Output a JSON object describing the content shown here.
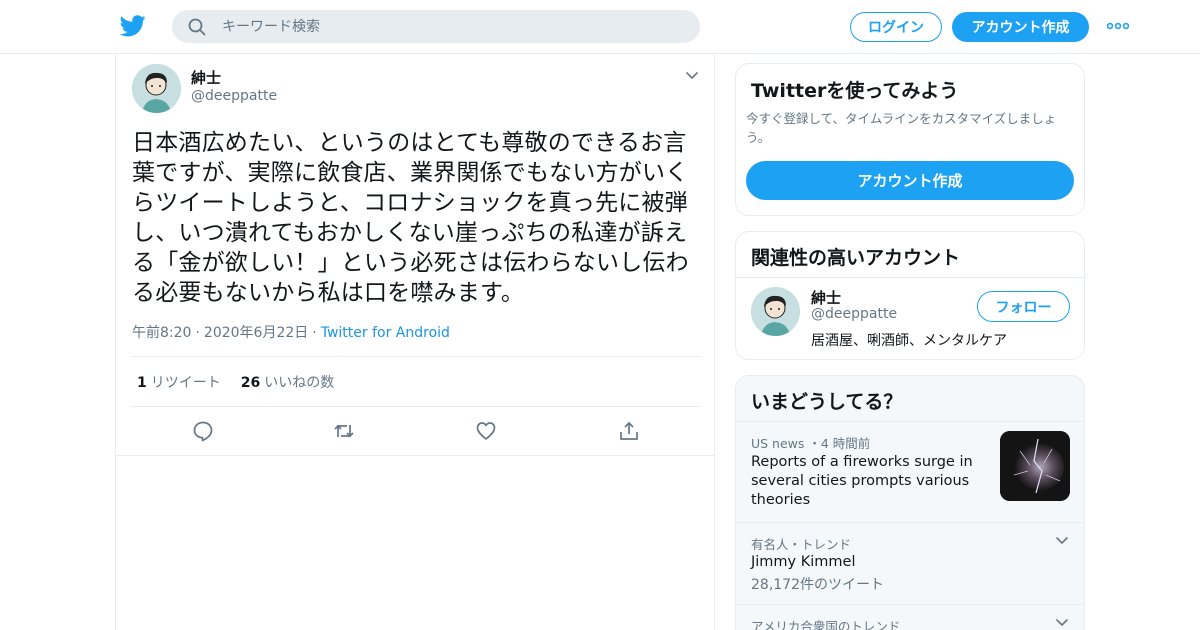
{
  "header": {
    "search_placeholder": "キーワード検索",
    "login_label": "ログイン",
    "signup_label": "アカウント作成"
  },
  "tweet": {
    "author_name": "紳士",
    "author_handle": "@deeppatte",
    "text": "日本酒広めたい、というのはとても尊敬のできるお言葉ですが、実際に飲食店、業界関係でもない方がいくらツイートしようと、コロナショックを真っ先に被弾し、いつ潰れてもおかしくない崖っぷちの私達が訴える「金が欲しい！」という必死さは伝わらないし伝わる必要もないから私は口を噤みます。",
    "time": "午前8:20",
    "date": "2020年6月22日",
    "source": "Twitter for Android",
    "retweet_count": "1",
    "retweet_label": "リツイート",
    "like_count": "26",
    "like_label": "いいねの数"
  },
  "signup_card": {
    "title": "Twitterを使ってみよう",
    "description": "今すぐ登録して、タイムラインをカスタマイズしましょう。",
    "button_label": "アカウント作成"
  },
  "related": {
    "title": "関連性の高いアカウント",
    "account": {
      "name": "紳士",
      "handle": "@deeppatte",
      "bio": "居酒屋、唎酒師、メンタルケア",
      "follow_label": "フォロー"
    }
  },
  "trends": {
    "title": "いまどうしてる？",
    "items": [
      {
        "meta": "US news ・4 時間前",
        "title": "Reports of a fireworks surge in several cities prompts various theories"
      },
      {
        "meta": "有名人・トレンド",
        "title": "Jimmy Kimmel",
        "count": "28,172件のツイート"
      },
      {
        "meta": "アメリカ合衆国のトレンド"
      }
    ]
  },
  "colors": {
    "brand_blue": "#1da1f2",
    "link_blue": "#1b95e0",
    "text_primary": "#14171a",
    "text_secondary": "#657786",
    "border": "#e6ecf0"
  }
}
